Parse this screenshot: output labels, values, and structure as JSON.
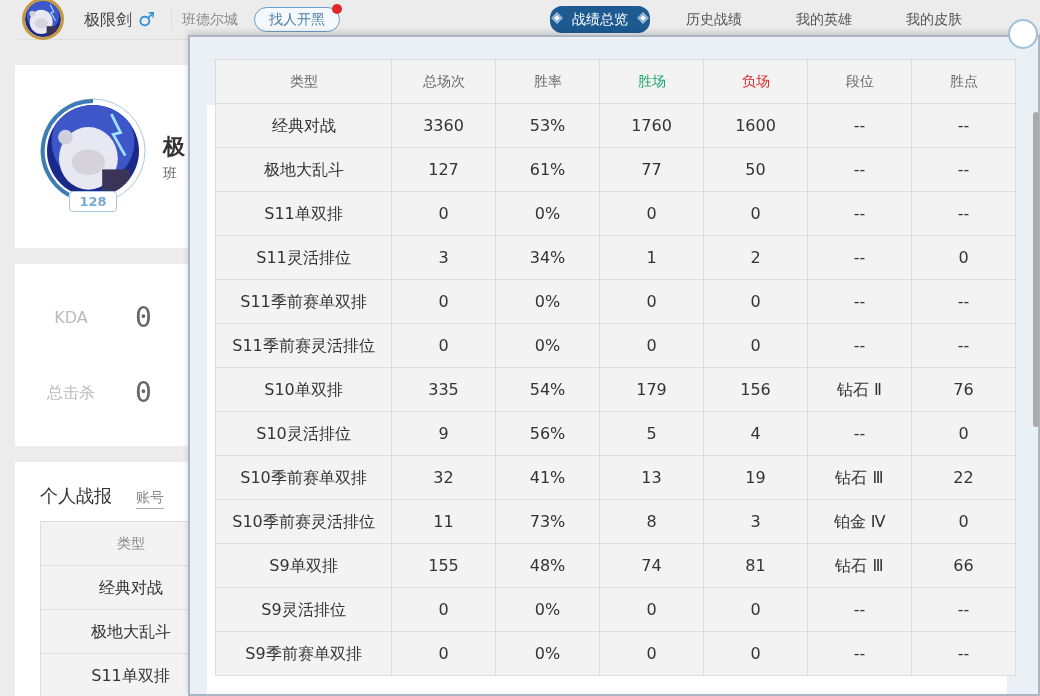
{
  "header": {
    "player_name": "极限剑",
    "gender_symbol": "♂",
    "server": "班德尔城",
    "team_up_button": {
      "label": "找人开黑",
      "notification": true
    }
  },
  "tabs": [
    {
      "label": "战绩总览",
      "selected": true
    },
    {
      "label": "历史战绩",
      "selected": false
    },
    {
      "label": "我的英雄",
      "selected": false
    },
    {
      "label": "我的皮肤",
      "selected": false
    }
  ],
  "profile_card": {
    "name": "极",
    "server": "班",
    "level": "128"
  },
  "stats": [
    {
      "label": "KDA",
      "value": "0"
    },
    {
      "label": "总击杀",
      "value": "0"
    }
  ],
  "report": {
    "title": "个人战报",
    "link": "账号",
    "table": {
      "columns": [
        "类型"
      ],
      "rows": [
        [
          "经典对战"
        ],
        [
          "极地大乱斗"
        ],
        [
          "S11单双排"
        ]
      ]
    }
  },
  "overview": {
    "columns": [
      {
        "label": "类型",
        "kind": "plain"
      },
      {
        "label": "总场次",
        "kind": "plain"
      },
      {
        "label": "胜率",
        "kind": "plain"
      },
      {
        "label": "胜场",
        "kind": "win"
      },
      {
        "label": "负场",
        "kind": "loss"
      },
      {
        "label": "段位",
        "kind": "plain"
      },
      {
        "label": "胜点",
        "kind": "plain"
      }
    ],
    "rows": [
      [
        "经典对战",
        "3360",
        "53%",
        "1760",
        "1600",
        "--",
        "--"
      ],
      [
        "极地大乱斗",
        "127",
        "61%",
        "77",
        "50",
        "--",
        "--"
      ],
      [
        "S11单双排",
        "0",
        "0%",
        "0",
        "0",
        "--",
        "--"
      ],
      [
        "S11灵活排位",
        "3",
        "34%",
        "1",
        "2",
        "--",
        "0"
      ],
      [
        "S11季前赛单双排",
        "0",
        "0%",
        "0",
        "0",
        "--",
        "--"
      ],
      [
        "S11季前赛灵活排位",
        "0",
        "0%",
        "0",
        "0",
        "--",
        "--"
      ],
      [
        "S10单双排",
        "335",
        "54%",
        "179",
        "156",
        "钻石 Ⅱ",
        "76"
      ],
      [
        "S10灵活排位",
        "9",
        "56%",
        "5",
        "4",
        "--",
        "0"
      ],
      [
        "S10季前赛单双排",
        "32",
        "41%",
        "13",
        "19",
        "钻石 Ⅲ",
        "22"
      ],
      [
        "S10季前赛灵活排位",
        "11",
        "73%",
        "8",
        "3",
        "铂金 Ⅳ",
        "0"
      ],
      [
        "S9单双排",
        "155",
        "48%",
        "74",
        "81",
        "钻石 Ⅲ",
        "66"
      ],
      [
        "S9灵活排位",
        "0",
        "0%",
        "0",
        "0",
        "--",
        "--"
      ],
      [
        "S9季前赛单双排",
        "0",
        "0%",
        "0",
        "0",
        "--",
        "--"
      ]
    ]
  }
}
